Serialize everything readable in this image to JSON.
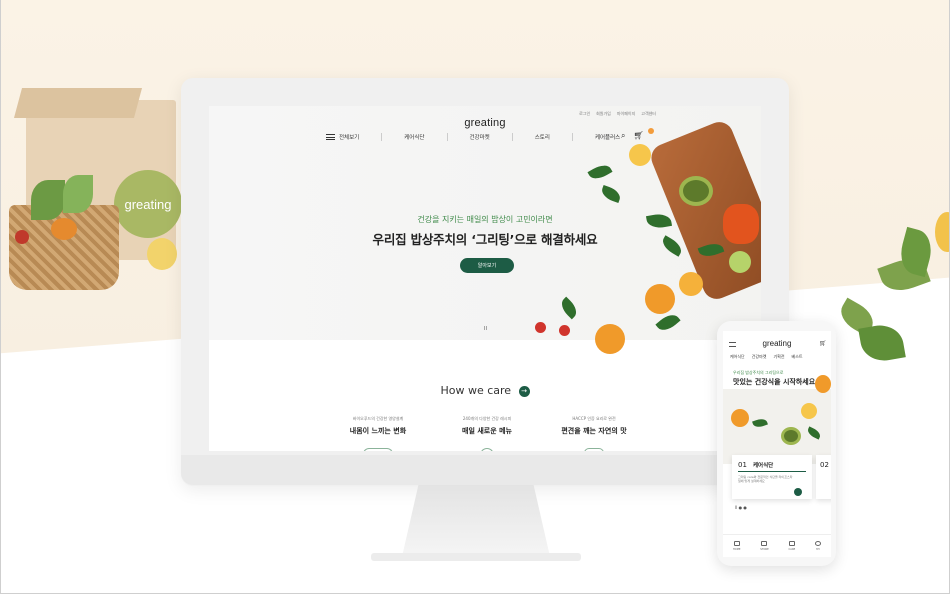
{
  "decor": {
    "box_logo": "greating"
  },
  "website": {
    "utility_links": [
      "로그인",
      "회원가입",
      "마이페이지",
      "고객센터"
    ],
    "brand": "greating",
    "nav": {
      "all_menu": "전체보기",
      "items": [
        "케어식단",
        "건강마켓",
        "스토리",
        "케어플러스"
      ]
    },
    "hero": {
      "subtitle": "건강을 지키는 매일의 밥상이 고민이라면",
      "title": "우리집 밥상주치의 ‘그리팅’으로 해결하세요",
      "button": "알아보기",
      "pause": "II"
    },
    "care": {
      "title": "How we care",
      "arrow": "→",
      "columns": [
        {
          "sub": "바이오푸드의 건강한 영양설계",
          "title": "내몸이 느끼는 변화"
        },
        {
          "sub": "240개의 다양한 건강 레시피",
          "title": "매일 새로운 메뉴"
        },
        {
          "sub": "HACCP 인증 요리로 완전",
          "title": "편견을 깨는 자연의 맛"
        }
      ]
    }
  },
  "mobile": {
    "brand": "greating",
    "tabs": [
      "케어식단",
      "건강마켓",
      "기획전",
      "베스트"
    ],
    "subtitle": "우리집 밥상주치의 그리팅으로",
    "title": "맛있는 건강식을 시작하세요",
    "card": {
      "number": "01",
      "name": "케어식단",
      "desc": "그리팅 care와 전문적인 식단을 라이프스타일에 맞게 설계하세요"
    },
    "card2_number": "02",
    "pager": "II ● ●",
    "bottom_nav": [
      "HOME",
      "STORE",
      "CARE",
      "MY"
    ]
  },
  "colors": {
    "brand_green": "#1d5c45",
    "accent_green": "#3f8a4a",
    "background": "#fbf3e6"
  }
}
